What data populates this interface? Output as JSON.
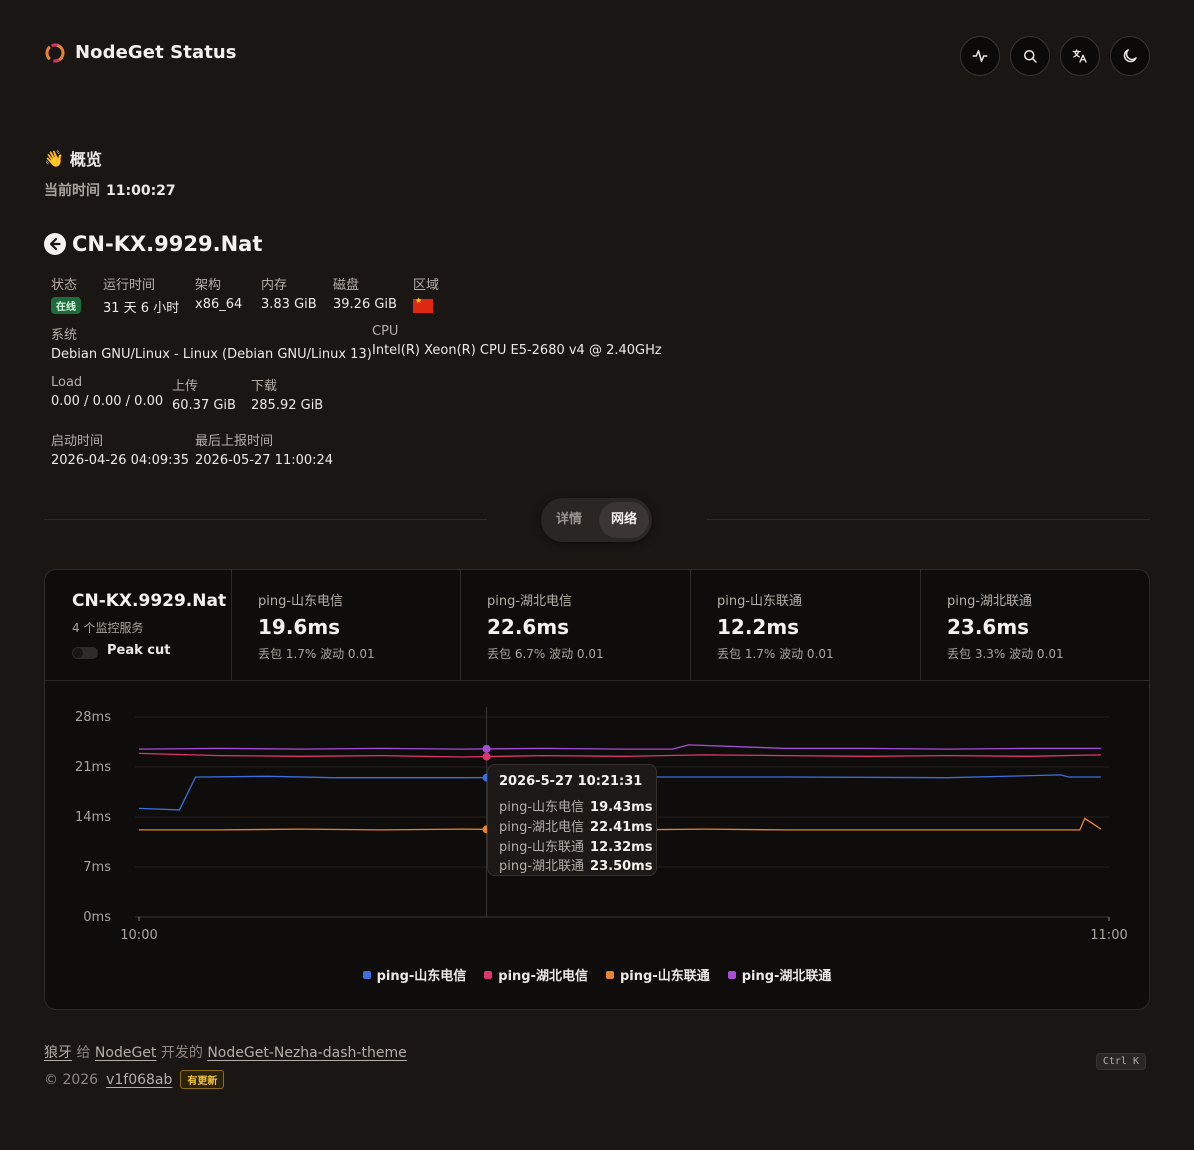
{
  "header": {
    "brand": "NodeGet Status",
    "icons": [
      "activity-icon",
      "search-icon",
      "translate-icon",
      "moon-icon"
    ]
  },
  "overview": {
    "emoji": "👋",
    "title": "概览",
    "time_label": "当前时间",
    "time_value": "11:00:27"
  },
  "node": {
    "name": "CN-KX.9929.Nat",
    "status_label": "状态",
    "status_value": "在线",
    "uptime_label": "运行时间",
    "uptime_value": "31 天 6 小时",
    "arch_label": "架构",
    "arch_value": "x86_64",
    "mem_label": "内存",
    "mem_value": "3.83 GiB",
    "disk_label": "磁盘",
    "disk_value": "39.26 GiB",
    "region_label": "区域",
    "os_label": "系统",
    "os_value": "Debian GNU/Linux - Linux (Debian GNU/Linux 13)",
    "cpu_label": "CPU",
    "cpu_value": "Intel(R) Xeon(R) CPU E5-2680 v4 @ 2.40GHz",
    "load_label": "Load",
    "load_value": "0.00 / 0.00 / 0.00",
    "up_label": "上传",
    "up_value": "60.37 GiB",
    "down_label": "下载",
    "down_value": "285.92 GiB",
    "boot_label": "启动时间",
    "boot_value": "2026-04-26 04:09:35",
    "report_label": "最后上报时间",
    "report_value": "2026-05-27 11:00:24"
  },
  "tabs": {
    "detail": "详情",
    "network": "网络"
  },
  "network": {
    "node_name": "CN-KX.9929.Nat",
    "monitor_count": "4 个监控服务",
    "peak_cut": "Peak cut",
    "metrics": [
      {
        "label": "ping-山东电信",
        "value": "19.6ms",
        "sub": "丢包 1.7% 波动 0.01"
      },
      {
        "label": "ping-湖北电信",
        "value": "22.6ms",
        "sub": "丢包 6.7% 波动 0.01"
      },
      {
        "label": "ping-山东联通",
        "value": "12.2ms",
        "sub": "丢包 1.7% 波动 0.01"
      },
      {
        "label": "ping-湖北联通",
        "value": "23.6ms",
        "sub": "丢包 3.3% 波动 0.01"
      }
    ],
    "tooltip": {
      "title": "2026-5-27 10:21:31",
      "rows": [
        {
          "name": "ping-山东电信",
          "value": "19.43ms"
        },
        {
          "name": "ping-湖北电信",
          "value": "22.41ms"
        },
        {
          "name": "ping-山东联通",
          "value": "12.32ms"
        },
        {
          "name": "ping-湖北联通",
          "value": "23.50ms"
        }
      ]
    }
  },
  "chart_data": {
    "type": "line",
    "yticks": [
      "0ms",
      "7ms",
      "14ms",
      "21ms",
      "28ms"
    ],
    "ylim": [
      0,
      28
    ],
    "xticks": [
      "10:00",
      "11:00"
    ],
    "xlim_minutes": [
      0,
      60
    ],
    "grid": true,
    "legend": "bottom-center",
    "hover_minute": 21.5,
    "series": [
      {
        "name": "ping-山东电信",
        "color": "#3b6fe0",
        "x": [
          0,
          2.5,
          3.5,
          4,
          8,
          12,
          20,
          30,
          40,
          50,
          57,
          57.5,
          59.5
        ],
        "y": [
          15.2,
          15.0,
          19.6,
          19.6,
          19.7,
          19.5,
          19.5,
          19.6,
          19.6,
          19.5,
          19.9,
          19.6,
          19.6
        ]
      },
      {
        "name": "ping-湖北电信",
        "color": "#e0356a",
        "x": [
          0,
          5,
          10,
          15,
          20,
          25,
          30,
          35,
          40,
          45,
          50,
          55,
          59.5
        ],
        "y": [
          22.9,
          22.6,
          22.5,
          22.6,
          22.4,
          22.6,
          22.5,
          22.7,
          22.6,
          22.5,
          22.6,
          22.5,
          22.7
        ]
      },
      {
        "name": "ping-山东联通",
        "color": "#e8842f",
        "x": [
          0,
          5,
          10,
          15,
          20,
          25,
          30,
          35,
          40,
          45,
          58.2,
          58.5,
          59.5
        ],
        "y": [
          12.2,
          12.2,
          12.3,
          12.2,
          12.3,
          12.2,
          12.2,
          12.3,
          12.2,
          12.2,
          12.2,
          13.8,
          12.3
        ]
      },
      {
        "name": "ping-湖北联通",
        "color": "#a64ed6",
        "x": [
          0,
          5,
          10,
          15,
          20,
          25,
          30,
          33,
          34,
          40,
          45,
          50,
          55,
          59.5
        ],
        "y": [
          23.5,
          23.6,
          23.5,
          23.6,
          23.5,
          23.6,
          23.5,
          23.5,
          24.1,
          23.6,
          23.6,
          23.5,
          23.6,
          23.6
        ]
      }
    ]
  },
  "footer": {
    "author": "狼牙",
    "give": "给",
    "project": "NodeGet",
    "dev": "开发的",
    "theme": "NodeGet-Nezha-dash-theme",
    "copyright": "© 2026",
    "version": "v1f068ab",
    "update_badge": "有更新",
    "kbd": "Ctrl K"
  }
}
